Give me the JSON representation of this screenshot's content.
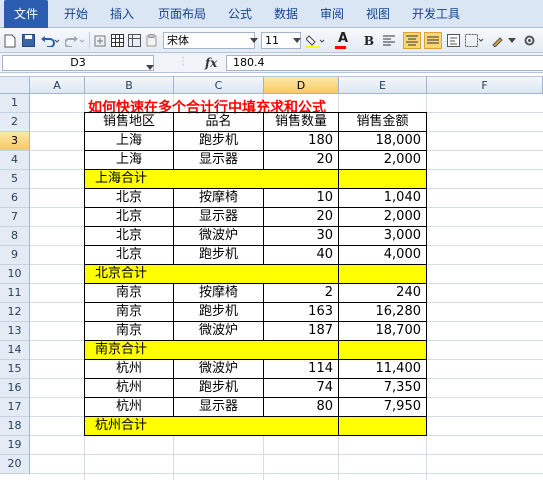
{
  "ribbon": {
    "tabs": [
      "文件",
      "开始",
      "插入",
      "页面布局",
      "公式",
      "数据",
      "审阅",
      "视图",
      "开发工具"
    ]
  },
  "toolbar": {
    "font_name": "宋体",
    "font_size": "11",
    "bold_label": "B",
    "font_color_label": "A",
    "accent_red": "#ff0000"
  },
  "formula_bar": {
    "name_box": "D3",
    "fx_label": "fx",
    "value": "180.4"
  },
  "sheet": {
    "columns": [
      "A",
      "B",
      "C",
      "D",
      "E",
      "F"
    ],
    "rows": [
      "1",
      "2",
      "3",
      "4",
      "5",
      "6",
      "7",
      "8",
      "9",
      "10",
      "11",
      "12",
      "13",
      "14",
      "15",
      "16",
      "17",
      "18",
      "19",
      "20"
    ],
    "title": "如何快速在多个合计行中填充求和公式",
    "header": [
      "销售地区",
      "品名",
      "销售数量",
      "销售金额"
    ],
    "data_rows": [
      [
        "上海",
        "跑步机",
        "180",
        "18,000"
      ],
      [
        "上海",
        "显示器",
        "20",
        "2,000"
      ],
      [
        "上海合计",
        "",
        "",
        ""
      ],
      [
        "北京",
        "按摩椅",
        "10",
        "1,040"
      ],
      [
        "北京",
        "显示器",
        "20",
        "2,000"
      ],
      [
        "北京",
        "微波炉",
        "30",
        "3,000"
      ],
      [
        "北京",
        "跑步机",
        "40",
        "4,000"
      ],
      [
        "北京合计",
        "",
        "",
        ""
      ],
      [
        "南京",
        "按摩椅",
        "2",
        "240"
      ],
      [
        "南京",
        "跑步机",
        "163",
        "16,280"
      ],
      [
        "南京",
        "微波炉",
        "187",
        "18,700"
      ],
      [
        "南京合计",
        "",
        "",
        ""
      ],
      [
        "杭州",
        "微波炉",
        "114",
        "11,400"
      ],
      [
        "杭州",
        "跑步机",
        "74",
        "7,350"
      ],
      [
        "杭州",
        "显示器",
        "80",
        "7,950"
      ],
      [
        "杭州合计",
        "",
        "",
        ""
      ]
    ],
    "subtotal_color": "#ffff00",
    "title_color": "#ff0000",
    "selected_cell": "D3"
  }
}
